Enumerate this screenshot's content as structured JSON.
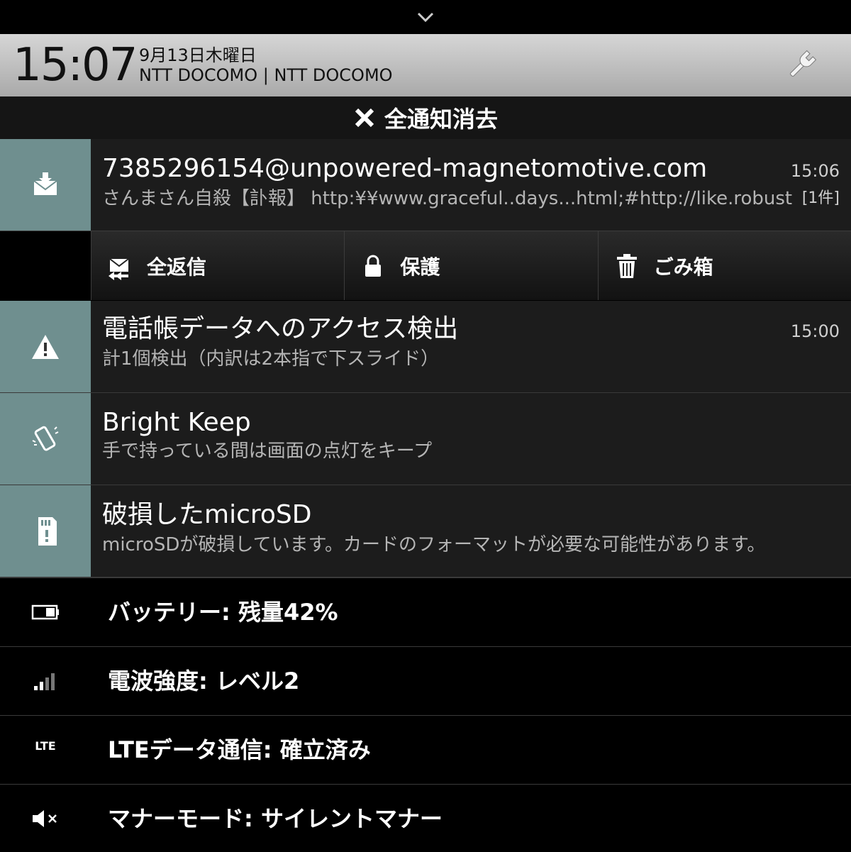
{
  "status_header": {
    "time": "15:07",
    "date": "9月13日木曜日",
    "carrier": "NTT DOCOMO | NTT DOCOMO"
  },
  "clear_all": {
    "label": "全通知消去"
  },
  "notifications": [
    {
      "icon": "mail-icon",
      "title": "7385296154@unpowered-magnetomotive.com",
      "subtitle": "さんまさん自殺【訃報】 http:¥¥www.graceful..days...html;#http://like.robusticity",
      "time": "15:06",
      "count": "[1件]"
    },
    {
      "icon": "warning-icon",
      "title": "電話帳データへのアクセス検出",
      "subtitle": "計1個検出（内訳は2本指で下スライド）",
      "time": "15:00"
    },
    {
      "icon": "phone-vibrate-icon",
      "title": "Bright Keep",
      "subtitle": "手で持っている間は画面の点灯をキープ"
    },
    {
      "icon": "sd-card-icon",
      "title": "破損したmicroSD",
      "subtitle": "microSDが破損しています。カードのフォーマットが必要な可能性があります。"
    }
  ],
  "mail_actions": [
    {
      "label": "全返信",
      "icon": "reply-all-icon"
    },
    {
      "label": "保護",
      "icon": "lock-icon"
    },
    {
      "label": "ごみ箱",
      "icon": "trash-icon"
    }
  ],
  "status_items": [
    {
      "icon": "battery-icon",
      "label": "バッテリー: 残量42%"
    },
    {
      "icon": "signal-icon",
      "label": "電波強度: レベル2"
    },
    {
      "icon": "lte-icon",
      "icon_text": "LTE",
      "label": "LTEデータ通信: 確立済み"
    },
    {
      "icon": "mute-icon",
      "label": "マナーモード: サイレントマナー"
    }
  ],
  "colors": {
    "accent_icon_bg": "#6f8f8f",
    "header_bg": "#bdbdbd",
    "notification_bg": "#1c1c1c"
  }
}
